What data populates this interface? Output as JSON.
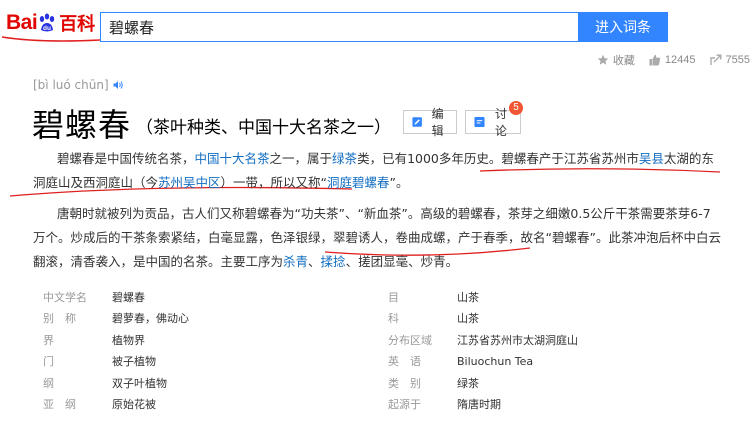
{
  "header": {
    "logo_bai": "Bai",
    "logo_du": "du",
    "logo_baike": "百科",
    "search_value": "碧螺春",
    "search_button": "进入词条"
  },
  "stats": {
    "favorite_label": "收藏",
    "like_count": "12445",
    "share_count": "7555"
  },
  "entry": {
    "pinyin": "[bì luó chūn]",
    "title": "碧螺春",
    "subtitle": "（茶叶种类、中国十大名茶之一）",
    "edit_label": "编辑",
    "discuss_label": "讨论",
    "discuss_badge": "5"
  },
  "paragraph1": {
    "t1": "碧螺春是中国传统名茶，",
    "link1": "中国十大名茶",
    "t2": "之一，属于",
    "link2": "绿茶",
    "t3": "类，已有1000多年历史。碧螺春产于江苏省苏州市",
    "link3": "吴县",
    "t4": "太湖的东洞庭山及西洞庭山（今",
    "link4": "苏州吴中区",
    "t5": "）一带，所以又称“",
    "link5": "洞庭碧螺春",
    "t6": "”。"
  },
  "paragraph2": {
    "t1": "唐朝时就被列为贡品，古人们又称碧螺春为“功夫茶”、“新血茶”。高级的碧螺春，茶芽之细嫩0.5公斤干茶需要茶芽6-7万个。炒成后的干茶条索紧结，白毫显露，色泽银绿，翠碧诱人，卷曲成螺，产于春季，故名“碧螺春”。此茶冲泡后杯中白云翻滚，清香袭入，是中国的名茶。主要工序为",
    "link1": "杀青",
    "t2": "、",
    "link2": "揉捻",
    "t3": "、搓团显毫、炒青。"
  },
  "info": {
    "left": [
      {
        "label": "中文学名",
        "value": "碧螺春"
      },
      {
        "label": "别　称",
        "value": "碧萝春，佛动心"
      },
      {
        "label": "界",
        "value": "植物界"
      },
      {
        "label": "门",
        "value": "被子植物"
      },
      {
        "label": "纲",
        "value": "双子叶植物"
      },
      {
        "label": "亚　纲",
        "value": "原始花被"
      }
    ],
    "right": [
      {
        "label": "目",
        "value": "山茶"
      },
      {
        "label": "科",
        "value": "山茶"
      },
      {
        "label": "分布区域",
        "value": "江苏省苏州市太湖洞庭山"
      },
      {
        "label": "英　语",
        "value": "Biluochun Tea"
      },
      {
        "label": "类　别",
        "value": "绿茶"
      },
      {
        "label": "起源于",
        "value": "隋唐时期"
      }
    ]
  },
  "colors": {
    "accent": "#3385ff",
    "brand_red": "#e10601",
    "link": "#136ec2",
    "annotation_red": "#e02020"
  }
}
